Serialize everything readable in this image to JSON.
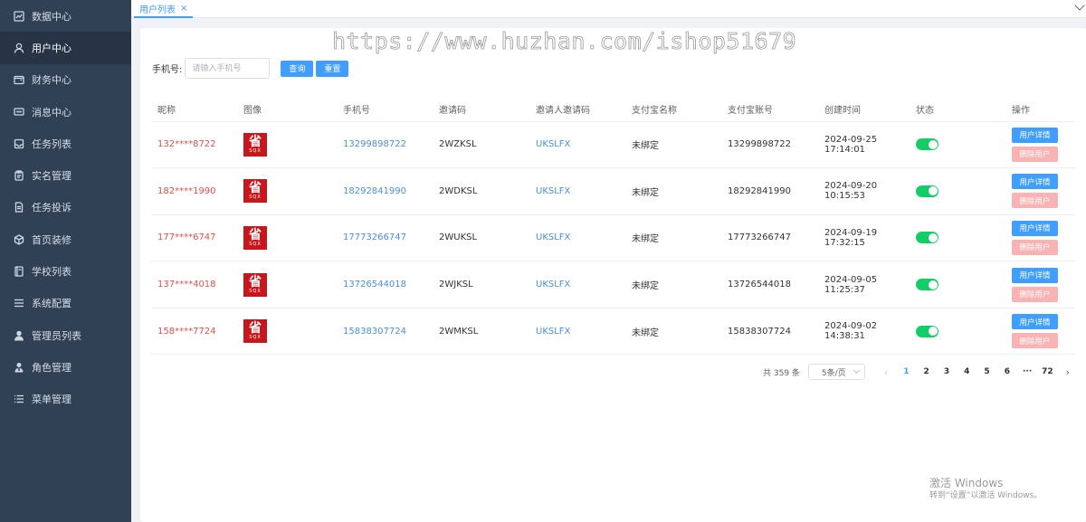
{
  "sidebar": {
    "items": [
      {
        "label": "数据中心",
        "icon": "chart-icon"
      },
      {
        "label": "用户中心",
        "icon": "user-icon"
      },
      {
        "label": "财务中心",
        "icon": "wallet-icon"
      },
      {
        "label": "消息中心",
        "icon": "message-icon"
      },
      {
        "label": "任务列表",
        "icon": "inbox-icon"
      },
      {
        "label": "实名管理",
        "icon": "clipboard-icon"
      },
      {
        "label": "任务投诉",
        "icon": "document-icon"
      },
      {
        "label": "首页装修",
        "icon": "box-icon"
      },
      {
        "label": "学校列表",
        "icon": "notebook-icon"
      },
      {
        "label": "系统配置",
        "icon": "menu-lines-icon"
      },
      {
        "label": "管理员列表",
        "icon": "person-solid-icon"
      },
      {
        "label": "角色管理",
        "icon": "role-icon"
      },
      {
        "label": "菜单管理",
        "icon": "list-icon"
      }
    ]
  },
  "tabs": {
    "active_label": "用户列表",
    "close": "×"
  },
  "watermark": "https://www.huzhan.com/ishop51679",
  "search": {
    "label": "手机号:",
    "placeholder": "请输入手机号",
    "query_btn": "查询",
    "reset_btn": "重置"
  },
  "table": {
    "headers": [
      "昵称",
      "图像",
      "手机号",
      "邀请码",
      "邀请人邀请码",
      "支付宝名称",
      "支付宝账号",
      "创建时间",
      "状态",
      "操作"
    ],
    "avatar_text": {
      "big": "省",
      "small": "SQX"
    },
    "detail_btn": "用户详情",
    "delete_btn": "删除用户",
    "rows": [
      {
        "nickname": "132****8722",
        "phone": "13299898722",
        "code": "2WZKSL",
        "inviter": "UKSLFX",
        "alipay_name": "未绑定",
        "alipay_account": "13299898722",
        "created": "2024-09-25 17:14:01"
      },
      {
        "nickname": "182****1990",
        "phone": "18292841990",
        "code": "2WDKSL",
        "inviter": "UKSLFX",
        "alipay_name": "未绑定",
        "alipay_account": "18292841990",
        "created": "2024-09-20 10:15:53"
      },
      {
        "nickname": "177****6747",
        "phone": "17773266747",
        "code": "2WUKSL",
        "inviter": "UKSLFX",
        "alipay_name": "未绑定",
        "alipay_account": "17773266747",
        "created": "2024-09-19 17:32:15"
      },
      {
        "nickname": "137****4018",
        "phone": "13726544018",
        "code": "2WJKSL",
        "inviter": "UKSLFX",
        "alipay_name": "未绑定",
        "alipay_account": "13726544018",
        "created": "2024-09-05 11:25:37"
      },
      {
        "nickname": "158****7724",
        "phone": "15838307724",
        "code": "2WMKSL",
        "inviter": "UKSLFX",
        "alipay_name": "未绑定",
        "alipay_account": "15838307724",
        "created": "2024-09-02 14:38:31"
      }
    ]
  },
  "pagination": {
    "total": "共 359 条",
    "page_size": "5条/页",
    "pages": [
      "1",
      "2",
      "3",
      "4",
      "5",
      "6",
      "···",
      "72"
    ],
    "prev": "‹",
    "next": "›"
  },
  "activation": {
    "title": "激活 Windows",
    "subtitle": "转到“设置”以激活 Windows。"
  },
  "colors": {
    "sidebar_bg": "#304156",
    "primary": "#409eff",
    "switch_on": "#13ce66",
    "nickname": "#d9534f",
    "danger_light": "#f9b3b3"
  }
}
